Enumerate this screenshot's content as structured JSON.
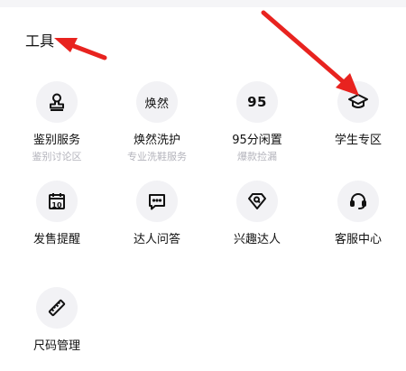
{
  "section": {
    "title": "工具"
  },
  "tools": [
    {
      "label": "鉴别服务",
      "sublabel": "鉴别讨论区",
      "icon": "stamp-icon"
    },
    {
      "label": "焕然洗护",
      "sublabel": "专业洗鞋服务",
      "icon": "huanran-logo-icon",
      "icon_text": "焕然"
    },
    {
      "label": "95分闲置",
      "sublabel": "爆款捡漏",
      "icon": "95-logo-icon",
      "icon_text": "95"
    },
    {
      "label": "学生专区",
      "icon": "graduation-cap-icon"
    },
    {
      "label": "发售提醒",
      "icon": "calendar-icon",
      "icon_text": "10"
    },
    {
      "label": "达人问答",
      "icon": "chat-icon"
    },
    {
      "label": "兴趣达人",
      "icon": "diamond-icon"
    },
    {
      "label": "客服中心",
      "icon": "headset-icon"
    },
    {
      "label": "尺码管理",
      "icon": "ruler-icon"
    }
  ],
  "colors": {
    "arrow": "#e8231f",
    "icon_bg": "#f2f2f5",
    "sub_text": "#b4b4bc"
  }
}
